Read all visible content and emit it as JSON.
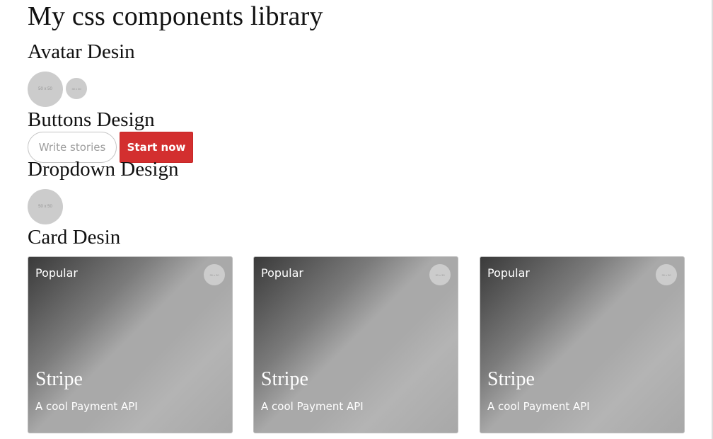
{
  "page": {
    "title": "My css components library"
  },
  "sections": {
    "avatar": "Avatar Desin",
    "buttons": "Buttons Design",
    "dropdown": "Dropdown Design",
    "card": "Card Desin"
  },
  "avatars": {
    "large_label": "50 x 50",
    "small_label": "30 x 30"
  },
  "buttons": {
    "outline_label": "Write stories",
    "primary_label": "Start now"
  },
  "dropdown": {
    "avatar_label": "50 x 50"
  },
  "cards": [
    {
      "tag": "Popular",
      "avatar_label": "30 x 30",
      "title": "Stripe",
      "description": "A cool Payment API"
    },
    {
      "tag": "Popular",
      "avatar_label": "30 x 30",
      "title": "Stripe",
      "description": "A cool Payment API"
    },
    {
      "tag": "Popular",
      "avatar_label": "30 x 30",
      "title": "Stripe",
      "description": "A cool Payment API"
    }
  ],
  "colors": {
    "primary_button": "#d32f2f",
    "avatar_placeholder": "#cccccc",
    "card_gradient_start": "#3a3a3a",
    "card_gradient_end": "#a8a8a8"
  }
}
